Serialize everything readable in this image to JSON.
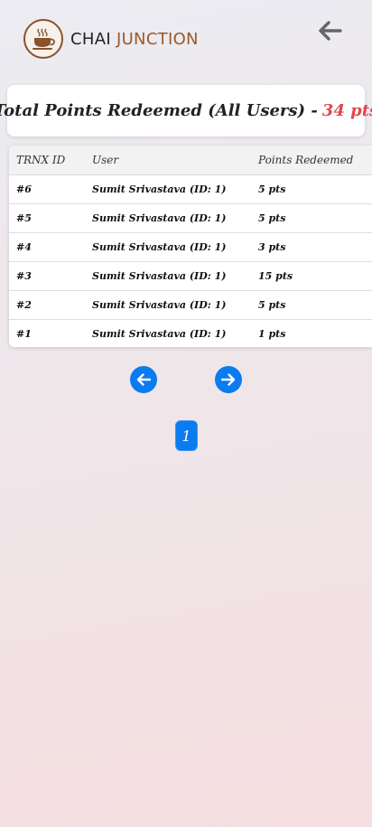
{
  "brand": {
    "name_part1": "CHAI",
    "name_part2": "JUNCTION",
    "logo_icon": "chai-cup-icon"
  },
  "header": {
    "back_icon": "arrow-left-icon"
  },
  "summary": {
    "label": "Total Points Redeemed (All Users) -",
    "value": "34 pts",
    "value_color": "#e0474c"
  },
  "table": {
    "headers": [
      "TRNX ID",
      "User",
      "Points Redeemed"
    ],
    "rows": [
      {
        "id": "#6",
        "user": "Sumit Srivastava (ID: 1)",
        "points": "5 pts"
      },
      {
        "id": "#5",
        "user": "Sumit Srivastava (ID: 1)",
        "points": "5 pts"
      },
      {
        "id": "#4",
        "user": "Sumit Srivastava (ID: 1)",
        "points": "3 pts"
      },
      {
        "id": "#3",
        "user": "Sumit Srivastava (ID: 1)",
        "points": "15 pts"
      },
      {
        "id": "#2",
        "user": "Sumit Srivastava (ID: 1)",
        "points": "5 pts"
      },
      {
        "id": "#1",
        "user": "Sumit Srivastava (ID: 1)",
        "points": "1 pts"
      }
    ]
  },
  "pagination": {
    "prev_icon": "arrow-left-icon",
    "next_icon": "arrow-right-icon",
    "current_page": "1",
    "accent_color": "#0b7bf0"
  }
}
